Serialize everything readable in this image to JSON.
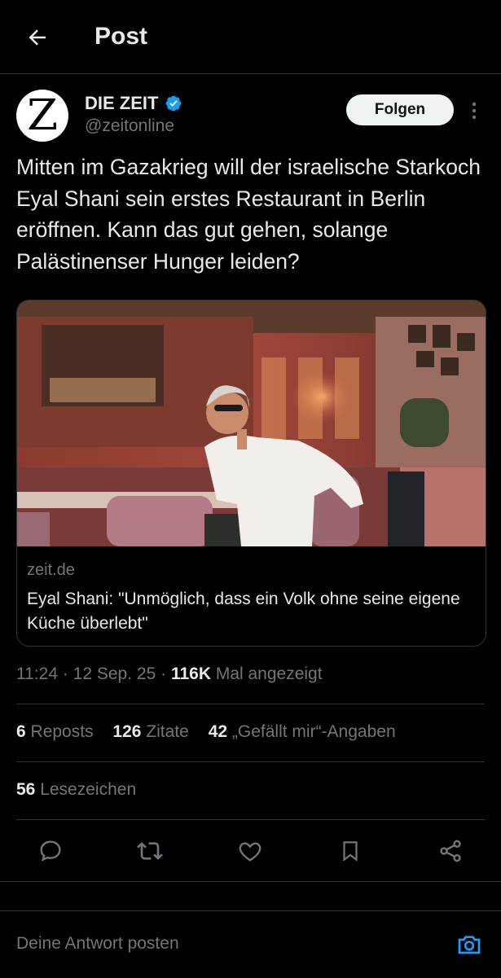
{
  "header": {
    "title": "Post"
  },
  "author": {
    "name": "DIE ZEIT",
    "handle": "@zeitonline",
    "avatar_letter": "Z",
    "follow_label": "Folgen"
  },
  "post": {
    "text": "Mitten im Gazakrieg will der israelische Starkoch Eyal Shani sein erstes Restaurant in Berlin eröffnen. Kann das gut gehen, solange Palästinenser Hunger leiden?"
  },
  "link_card": {
    "domain": "zeit.de",
    "title": "Eyal Shani: \"Unmöglich, dass ein Volk ohne seine eigene Küche überlebt\""
  },
  "meta": {
    "time": "11:24",
    "date": "12 Sep. 25",
    "views_count": "116K",
    "views_label": "Mal angezeigt"
  },
  "stats": {
    "reposts": {
      "count": "6",
      "label": "Reposts"
    },
    "quotes": {
      "count": "126",
      "label": "Zitate"
    },
    "likes": {
      "count": "42",
      "label": "„Gefällt mir“-Angaben"
    },
    "bookmarks": {
      "count": "56",
      "label": "Lesezeichen"
    }
  },
  "actions": [
    "reply-icon",
    "repost-icon",
    "like-icon",
    "bookmark-icon",
    "share-icon"
  ],
  "reply_bar": {
    "placeholder": "Deine Antwort posten"
  },
  "colors": {
    "background": "#000000",
    "text": "#e7e9ea",
    "muted": "#71767b",
    "accent": "#1d9bf0",
    "border": "#2f3336"
  }
}
